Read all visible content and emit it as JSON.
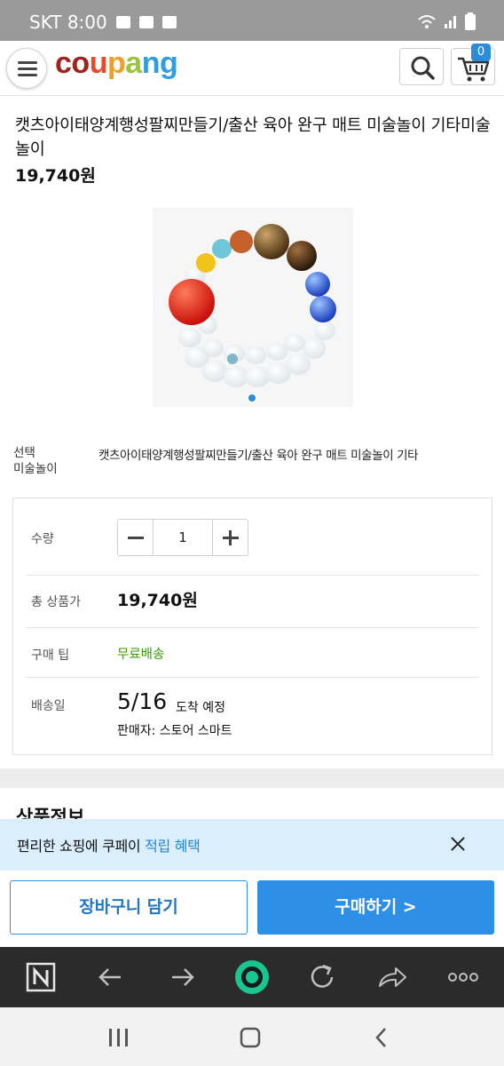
{
  "status_bar": {
    "carrier_time": "SKT 8:00"
  },
  "header": {
    "logo_letters": [
      {
        "ch": "c",
        "color": "#a0231e"
      },
      {
        "ch": "o",
        "color": "#a0231e"
      },
      {
        "ch": "u",
        "color": "#e84a2a"
      },
      {
        "ch": "p",
        "color": "#f0a020"
      },
      {
        "ch": "a",
        "color": "#9ac43a"
      },
      {
        "ch": "n",
        "color": "#2f9ee0"
      },
      {
        "ch": "g",
        "color": "#2f9ee0"
      }
    ],
    "cart_count": "0"
  },
  "product": {
    "title": "캣츠아이태양계행성팔찌만들기/출산 육아 완구 매트 미술놀이 기타미술놀이",
    "price": "19,740원",
    "option_label": "선택\n미술놀이",
    "option_label_line1": "선택",
    "option_label_line2": "미술놀이",
    "option_value": "캣츠아이태양계행성팔찌만들기/출산 육아 완구 매트 미술놀이 기타"
  },
  "options_box": {
    "qty_label": "수량",
    "qty_value": "1",
    "total_label": "총 상품가",
    "total_value": "19,740원",
    "tip_label": "구매 팁",
    "tip_value": "무료배송",
    "delivery_label": "배송일",
    "delivery_date": "5/16",
    "delivery_suffix": "도착 예정",
    "seller": "판매자: 스토어 스마트"
  },
  "section": {
    "title": "상품정보"
  },
  "banner": {
    "text_plain": "편리한 쇼핑에 쿠페이 ",
    "text_highlight": "적립 혜택"
  },
  "actions": {
    "add_to_cart": "장바구니 담기",
    "buy_now": "구매하기 >"
  },
  "colors": {
    "accent": "#2e8fe6",
    "free_shipping": "#3a9a0a",
    "banner_bg": "#dbeefb"
  }
}
